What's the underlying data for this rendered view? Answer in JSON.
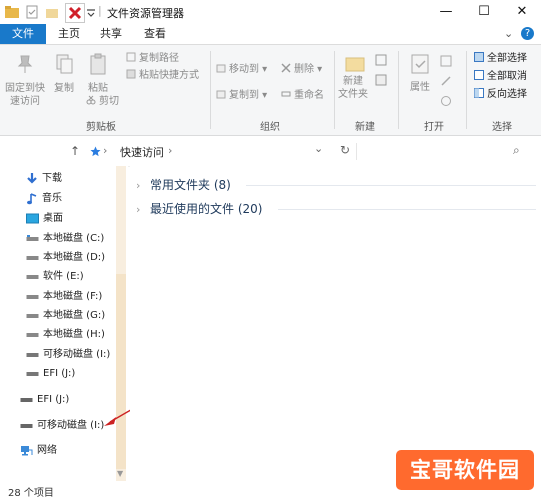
{
  "window": {
    "title": "文件资源管理器",
    "controls": {
      "minimize": "—",
      "maximize": "☐",
      "close": "✕",
      "collapse": "⌄",
      "help": "?"
    }
  },
  "tabs": [
    {
      "label": "文件",
      "active": true
    },
    {
      "label": "主页"
    },
    {
      "label": "共享"
    },
    {
      "label": "查看"
    }
  ],
  "ribbon": {
    "groups": {
      "clipboard": "剪贴板",
      "organize": "组织",
      "new": "新建",
      "open": "打开",
      "select": "选择"
    },
    "pin": {
      "line1": "固定到快",
      "line2": "速访问"
    },
    "copy": "复制",
    "paste": "粘贴",
    "copy_path": "复制路径",
    "paste_shortcut": "粘贴快捷方式",
    "cut": "剪切",
    "move_to": "移动到",
    "copy_to": "复制到",
    "delete": "删除",
    "rename": "重命名",
    "new_folder": {
      "line1": "新建",
      "line2": "文件夹"
    },
    "properties": "属性",
    "select_all": "全部选择",
    "select_none": "全部取消",
    "invert_selection": "反向选择"
  },
  "address": {
    "path": "快速访问",
    "up_glyph": "↑",
    "refresh_glyph": "↻",
    "dropdown_glyph": "⌄",
    "search_glyph": "⌕",
    "separator_glyph": "›"
  },
  "sidebar": {
    "items": [
      {
        "label": "下载",
        "icon": "download-icon"
      },
      {
        "label": "音乐",
        "icon": "music-icon"
      },
      {
        "label": "桌面",
        "icon": "desktop-icon"
      },
      {
        "label": "本地磁盘 (C:)",
        "icon": "drive-icon"
      },
      {
        "label": "本地磁盘 (D:)",
        "icon": "drive-icon"
      },
      {
        "label": "软件 (E:)",
        "icon": "drive-icon"
      },
      {
        "label": "本地磁盘 (F:)",
        "icon": "drive-icon"
      },
      {
        "label": "本地磁盘 (G:)",
        "icon": "drive-icon"
      },
      {
        "label": "本地磁盘 (H:)",
        "icon": "drive-icon"
      },
      {
        "label": "可移动磁盘 (I:)",
        "icon": "drive-icon"
      },
      {
        "label": "EFI (J:)",
        "icon": "drive-icon"
      },
      {
        "label": "EFI (J:)",
        "icon": "drive-icon"
      },
      {
        "label": "可移动磁盘 (I:)",
        "icon": "drive-icon"
      },
      {
        "label": "网络",
        "icon": "network-icon"
      }
    ]
  },
  "content": {
    "groups": [
      {
        "label": "常用文件夹 (8)"
      },
      {
        "label": "最近使用的文件 (20)"
      }
    ]
  },
  "status": {
    "count": "28 个项目"
  },
  "watermark": {
    "text": "宝哥软件园"
  },
  "colors": {
    "accent": "#1979ca",
    "annotation_arrow": "#cc2222",
    "watermark_bg": "#ff6a2e",
    "scrollbar": "#f4e3c8"
  }
}
